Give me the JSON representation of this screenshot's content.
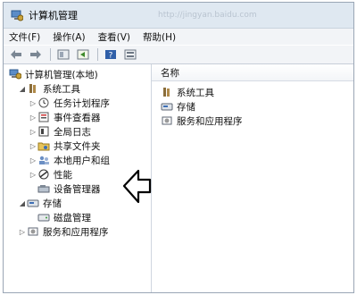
{
  "window": {
    "title": "计算机管理",
    "watermark": "http://jingyan.baidu.com"
  },
  "menu": [
    "文件(F)",
    "操作(A)",
    "查看(V)",
    "帮助(H)"
  ],
  "toolbar": {
    "icons": [
      "back-icon",
      "forward-icon",
      "up-folder-icon",
      "show-tree-icon",
      "help-icon",
      "properties-icon"
    ]
  },
  "tree": {
    "root": "计算机管理(本地)",
    "system_tools": "系统工具",
    "task_scheduler": "任务计划程序",
    "event_viewer": "事件查看器",
    "global_log": "全局日志",
    "shared_folders": "共享文件夹",
    "local_users": "本地用户和组",
    "performance": "性能",
    "device_manager": "设备管理器",
    "storage": "存储",
    "disk_management": "磁盘管理",
    "services_apps": "服务和应用程序"
  },
  "list": {
    "header": "名称",
    "items": [
      "系统工具",
      "存储",
      "服务和应用程序"
    ]
  },
  "colors": {
    "window_border": "#9aa6b5",
    "title_bg": "#dfe8f1"
  }
}
